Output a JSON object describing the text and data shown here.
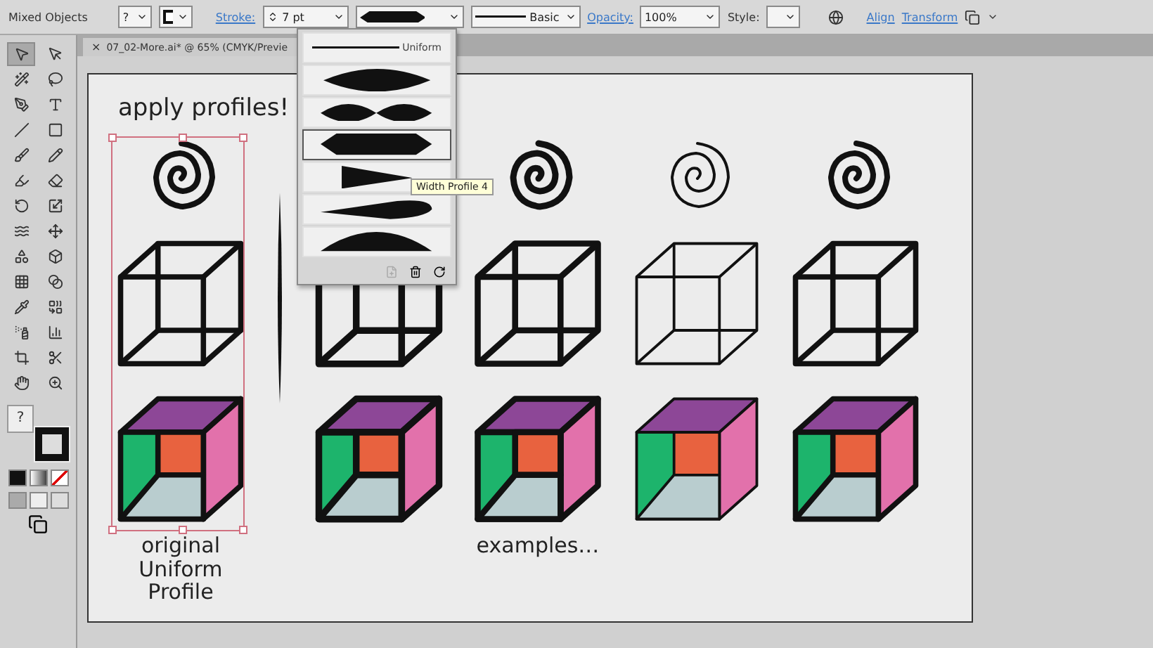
{
  "control_bar": {
    "selection_label": "Mixed Objects",
    "fill_value": "?",
    "stroke_link": "Stroke:",
    "stroke_weight": "7 pt",
    "profile": {
      "kind": "hexagon"
    },
    "brush_label": "Basic",
    "opacity_link": "Opacity:",
    "opacity_value": "100%",
    "style_label": "Style:",
    "links": [
      "Align",
      "Transform"
    ]
  },
  "document_tab": {
    "close": "×",
    "title": "07_02-More.ai* @ 65% (CMYK/Previe"
  },
  "tools": [
    {
      "kind": "selection",
      "selected": true
    },
    {
      "kind": "direct-selection",
      "selected": false
    },
    {
      "kind": "magic-wand",
      "selected": false
    },
    {
      "kind": "lasso",
      "selected": false
    },
    {
      "kind": "pen",
      "selected": false
    },
    {
      "kind": "type",
      "selected": false
    },
    {
      "kind": "line",
      "selected": false
    },
    {
      "kind": "rectangle",
      "selected": false
    },
    {
      "kind": "paintbrush",
      "selected": false
    },
    {
      "kind": "pencil",
      "selected": false
    },
    {
      "kind": "blob-brush",
      "selected": false
    },
    {
      "kind": "eraser",
      "selected": false
    },
    {
      "kind": "rotate",
      "selected": false
    },
    {
      "kind": "scale",
      "selected": false
    },
    {
      "kind": "warp",
      "selected": false
    },
    {
      "kind": "free-transform",
      "selected": false
    },
    {
      "kind": "shape-builder",
      "selected": false
    },
    {
      "kind": "perspective",
      "selected": false
    },
    {
      "kind": "mesh",
      "selected": false
    },
    {
      "kind": "gradient",
      "selected": false
    },
    {
      "kind": "eyedropper",
      "selected": false
    },
    {
      "kind": "blend",
      "selected": false
    },
    {
      "kind": "sprayer",
      "selected": false
    },
    {
      "kind": "graph",
      "selected": false
    },
    {
      "kind": "artboard",
      "selected": false
    },
    {
      "kind": "slice",
      "selected": false
    },
    {
      "kind": "hand",
      "selected": false
    },
    {
      "kind": "zoom",
      "selected": false
    }
  ],
  "fill_stroke": {
    "fill_label": "?"
  },
  "artboard": {
    "heading": "apply profiles!",
    "columns": [
      {
        "kind": "uniform",
        "selected": true,
        "caption": "original\nUniform\nProfile"
      },
      {
        "kind": "hexagon",
        "selected": false
      },
      {
        "kind": "pinch",
        "selected": false,
        "caption": "examples…"
      },
      {
        "kind": "thin",
        "selected": false
      },
      {
        "kind": "taper",
        "selected": false
      }
    ]
  },
  "profile_menu": {
    "items": [
      {
        "kind": "uniform",
        "label": "Uniform",
        "selected": false
      },
      {
        "kind": "lens",
        "selected": false
      },
      {
        "kind": "pinch",
        "selected": false
      },
      {
        "kind": "hexagon",
        "selected": true
      },
      {
        "kind": "wedge",
        "selected": false
      },
      {
        "kind": "taper",
        "selected": false
      },
      {
        "kind": "arc",
        "selected": false
      }
    ],
    "tooltip": "Width Profile 4"
  }
}
